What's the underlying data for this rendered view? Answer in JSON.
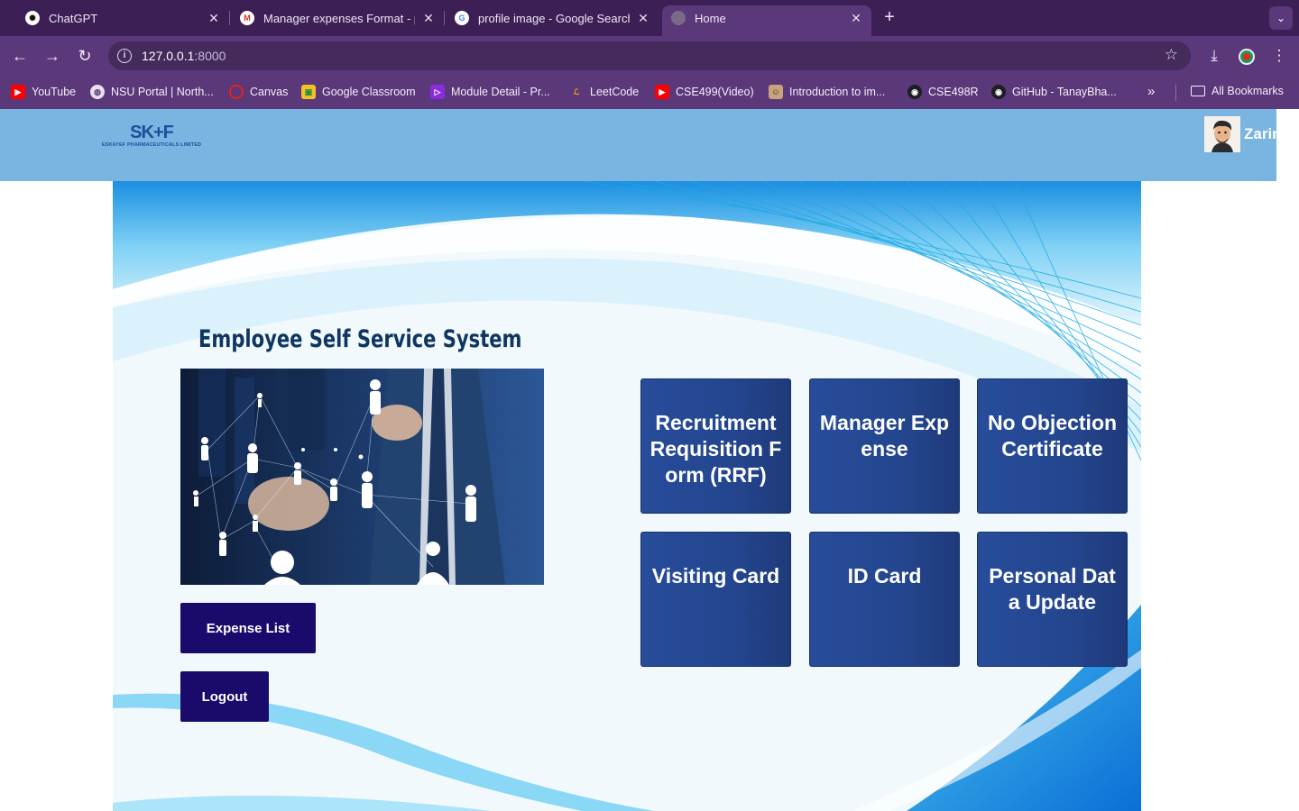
{
  "browser": {
    "tabs": [
      {
        "title": "ChatGPT",
        "active": false
      },
      {
        "title": "Manager expenses Format - p",
        "active": false
      },
      {
        "title": "profile image - Google Search",
        "active": false
      },
      {
        "title": "Home",
        "active": true
      }
    ],
    "address": {
      "host": "127.0.0.1",
      "port": ":8000"
    },
    "bookmarks": [
      {
        "label": "YouTube",
        "icon": "youtube-icon"
      },
      {
        "label": "NSU Portal | North...",
        "icon": "globe-icon"
      },
      {
        "label": "Canvas",
        "icon": "canvas-icon"
      },
      {
        "label": "Google Classroom",
        "icon": "classroom-icon"
      },
      {
        "label": "Module Detail - Pr...",
        "icon": "module-icon"
      },
      {
        "label": "LeetCode",
        "icon": "leetcode-icon"
      },
      {
        "label": "CSE499(Video)",
        "icon": "youtube-icon"
      },
      {
        "label": "Introduction to im...",
        "icon": "avatar-icon"
      },
      {
        "label": "CSE498R",
        "icon": "github-icon"
      },
      {
        "label": "GitHub - TanayBha...",
        "icon": "github-icon"
      }
    ],
    "all_bookmarks": "All Bookmarks"
  },
  "header": {
    "logo_mark": "SK+F",
    "logo_sub": "ESKAYEF PHARMACEUTICALS LIMITED",
    "user_name": "Zarin"
  },
  "main": {
    "title": "Employee Self Service System",
    "buttons": {
      "expense_list": "Expense List",
      "logout": "Logout"
    },
    "tiles": [
      {
        "label": "Recruitment Requisition Form (RRF)"
      },
      {
        "label": "Manager Expense"
      },
      {
        "label": "No Objection Certificate"
      },
      {
        "label": "Visiting Card"
      },
      {
        "label": "ID Card"
      },
      {
        "label": "Personal Data Update"
      }
    ]
  },
  "colors": {
    "tab_bar": "#3c1f55",
    "toolbar": "#5b3879",
    "header": "#7ab4e1",
    "tile": "#24468f",
    "dark_button": "#1a0a6b",
    "title_text": "#0f3660"
  }
}
